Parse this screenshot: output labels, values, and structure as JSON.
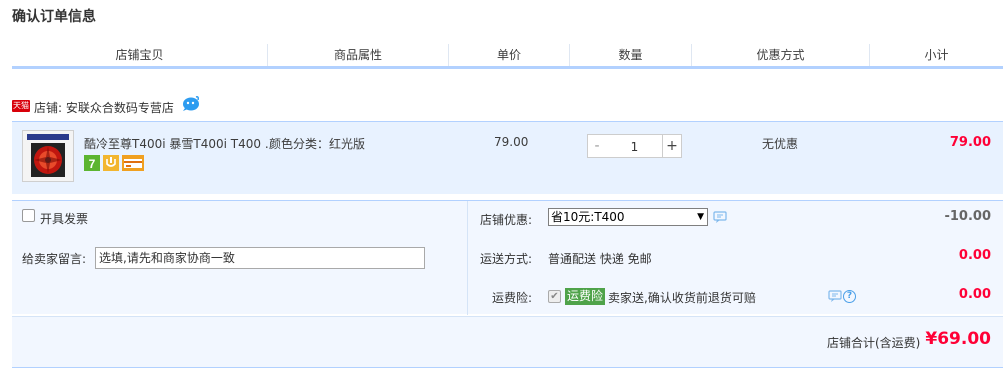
{
  "page": {
    "title": "确认订单信息"
  },
  "columns": [
    "店铺宝贝",
    "商品属性",
    "单价",
    "数量",
    "优惠方式",
    "小计"
  ],
  "shop": {
    "badge": "天猫",
    "name": "店铺: 安联众合数码专营店"
  },
  "item": {
    "title": "酷冷至尊T400i 暴雪T400i T400 ...",
    "attribute": "颜色分类：红光版",
    "unit_price": "79.00",
    "quantity": "1",
    "qty_minus": "-",
    "qty_plus": "+",
    "discount": "无优惠",
    "subtotal": "79.00",
    "service_icons": [
      "7-day-return-icon",
      "guarantee-icon",
      "credit-card-icon"
    ]
  },
  "options": {
    "invoice_label": "开具发票",
    "message_label": "给卖家留言:",
    "message_placeholder": "选填,请先和商家协商一致",
    "coupon_label": "店铺优惠:",
    "coupon_value": "省10元:T400",
    "coupon_amount": "-10.00",
    "shipping_label": "运送方式:",
    "shipping_value": "普通配送 快递 免邮",
    "shipping_amount": "0.00",
    "insurance_label": "运费险:",
    "insurance_tag": "运费险",
    "insurance_text": "卖家送,确认收货前退货可赔",
    "insurance_amount": "0.00"
  },
  "total": {
    "label": "店铺合计(含运费)",
    "value": "¥69.00"
  },
  "colors": {
    "accent_blue": "#b2d1ff",
    "price_red": "#ff0036",
    "item_bg": "#e8f2ff",
    "panel_bg": "#f2f7ff",
    "tmall_red": "#d8000a",
    "insurance_green": "#4fa34a"
  }
}
